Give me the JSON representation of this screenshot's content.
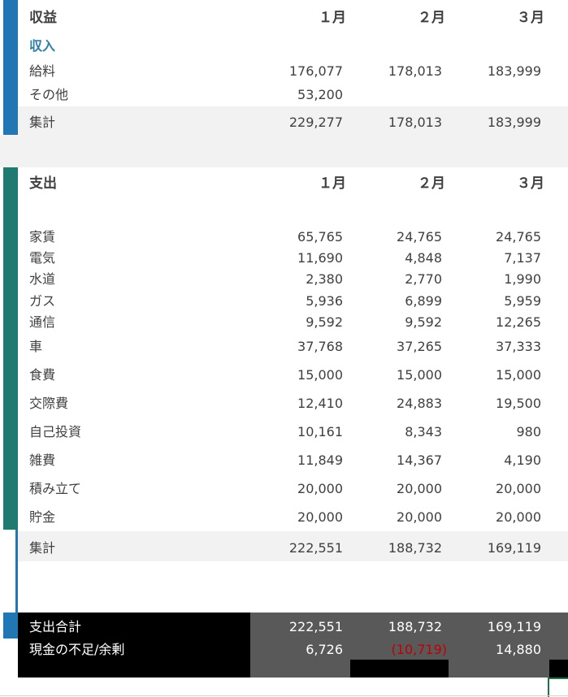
{
  "colors": {
    "income_accent": "#2077b4",
    "expense_accent": "#1f7a70",
    "band": "#f2f2f2",
    "negative": "#c00000",
    "dark_fill": "#000000",
    "gray_fill": "#595959"
  },
  "income": {
    "title": "収益",
    "months": [
      "１月",
      "２月",
      "３月"
    ],
    "subheader": "収入",
    "rows": [
      {
        "label": "給料",
        "values": [
          "176,077",
          "178,013",
          "183,999"
        ]
      },
      {
        "label": "その他",
        "values": [
          "53,200",
          "",
          ""
        ]
      }
    ],
    "total": {
      "label": "集計",
      "values": [
        "229,277",
        "178,013",
        "183,999"
      ]
    }
  },
  "expense": {
    "title": "支出",
    "months": [
      "１月",
      "２月",
      "３月"
    ],
    "rows": [
      {
        "label": "家賃",
        "values": [
          "65,765",
          "24,765",
          "24,765"
        ]
      },
      {
        "label": "電気",
        "values": [
          "11,690",
          "4,848",
          "7,137"
        ]
      },
      {
        "label": "水道",
        "values": [
          "2,380",
          "2,770",
          "1,990"
        ]
      },
      {
        "label": "ガス",
        "values": [
          "5,936",
          "6,899",
          "5,959"
        ]
      },
      {
        "label": "通信",
        "values": [
          "9,592",
          "9,592",
          "12,265"
        ]
      },
      {
        "label": "車",
        "values": [
          "37,768",
          "37,265",
          "37,333"
        ]
      },
      {
        "label": "食費",
        "values": [
          "15,000",
          "15,000",
          "15,000"
        ]
      },
      {
        "label": "交際費",
        "values": [
          "12,410",
          "24,883",
          "19,500"
        ]
      },
      {
        "label": "自己投資",
        "values": [
          "10,161",
          "8,343",
          "980"
        ]
      },
      {
        "label": "雑費",
        "values": [
          "11,849",
          "14,367",
          "4,190"
        ]
      },
      {
        "label": "積み立て",
        "values": [
          "20,000",
          "20,000",
          "20,000"
        ]
      },
      {
        "label": "貯金",
        "values": [
          "20,000",
          "20,000",
          "20,000"
        ]
      }
    ],
    "total": {
      "label": "集計",
      "values": [
        "222,551",
        "188,732",
        "169,119"
      ]
    }
  },
  "summary": {
    "rows": [
      {
        "label": "支出合計",
        "values": [
          "222,551",
          "188,732",
          "169,119"
        ]
      },
      {
        "label": "現金の不足/余剰",
        "values": [
          "6,726",
          "(10,719)",
          "14,880"
        ]
      }
    ]
  }
}
